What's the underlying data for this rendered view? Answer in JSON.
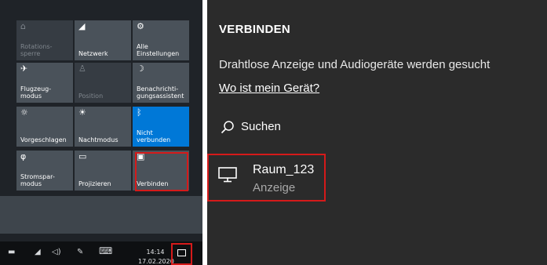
{
  "action_center": {
    "tiles": [
      {
        "label": "Rotations-\nsperre",
        "icon": "rotation-lock-icon",
        "glyph": "⌂",
        "state": "disabled"
      },
      {
        "label": "Netzwerk",
        "icon": "network-icon",
        "glyph": "◢",
        "state": "normal"
      },
      {
        "label": "Alle\nEinstellungen",
        "icon": "gear-icon",
        "glyph": "⚙",
        "state": "normal"
      },
      {
        "label": "Flugzeug-\nmodus",
        "icon": "airplane-icon",
        "glyph": "✈",
        "state": "normal"
      },
      {
        "label": "Position",
        "icon": "location-icon",
        "glyph": "♙",
        "state": "disabled"
      },
      {
        "label": "Benachrichti-\ngungsassistent",
        "icon": "moon-icon",
        "glyph": "☽",
        "state": "normal"
      },
      {
        "label": "Vorgeschlagen",
        "icon": "brightness-icon",
        "glyph": "☼",
        "state": "normal"
      },
      {
        "label": "Nachtmodus",
        "icon": "night-light-icon",
        "glyph": "☀",
        "state": "normal"
      },
      {
        "label": "Nicht\nverbunden",
        "icon": "bluetooth-icon",
        "glyph": "ᛒ",
        "state": "active"
      },
      {
        "label": "Stromspar-\nmodus",
        "icon": "battery-saver-icon",
        "glyph": "φ",
        "state": "normal"
      },
      {
        "label": "Projizieren",
        "icon": "project-icon",
        "glyph": "▭",
        "state": "normal"
      },
      {
        "label": "Verbinden",
        "icon": "connect-icon",
        "glyph": "▣",
        "state": "normal"
      }
    ]
  },
  "taskbar": {
    "time": "14:14",
    "date": "17.02.2020",
    "icons": [
      "battery-icon",
      "wifi-icon",
      "volume-icon",
      "pen-icon",
      "keyboard-icon"
    ]
  },
  "connect": {
    "title": "VERBINDEN",
    "status": "Drahtlose Anzeige und Audiogeräte werden gesucht",
    "link": "Wo ist mein Gerät?",
    "search_label": "Suchen",
    "device": {
      "name": "Raum_123",
      "type": "Anzeige",
      "icon": "monitor-icon"
    }
  },
  "colors": {
    "highlight": "#d51a1a",
    "active_tile": "#0078d7",
    "tile": "#4a525a",
    "panel": "#2b2b2b"
  }
}
